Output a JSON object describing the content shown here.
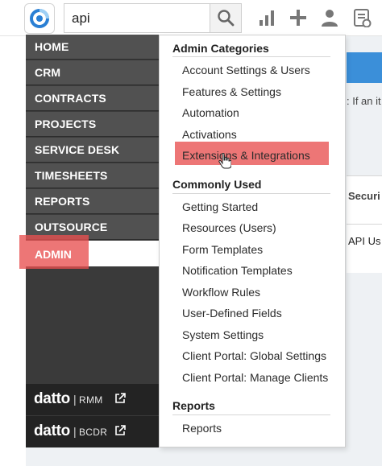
{
  "search": {
    "value": "api"
  },
  "nav": {
    "items": [
      {
        "label": "HOME"
      },
      {
        "label": "CRM"
      },
      {
        "label": "CONTRACTS"
      },
      {
        "label": "PROJECTS"
      },
      {
        "label": "SERVICE DESK"
      },
      {
        "label": "TIMESHEETS"
      },
      {
        "label": "REPORTS"
      },
      {
        "label": "OUTSOURCE"
      }
    ],
    "active": {
      "label": "ADMIN"
    },
    "footer": [
      {
        "brand": "datto",
        "separator": "|",
        "product": "RMM"
      },
      {
        "brand": "datto",
        "separator": "|",
        "product": "BCDR"
      }
    ]
  },
  "menu": {
    "admin_categories": {
      "title": "Admin Categories",
      "items": [
        "Account Settings & Users",
        "Features & Settings",
        "Automation",
        "Activations",
        "Extensions & Integrations"
      ]
    },
    "commonly_used": {
      "title": "Commonly Used",
      "items": [
        "Getting Started",
        "Resources (Users)",
        "Form Templates",
        "Notification Templates",
        "Workflow Rules",
        "User-Defined Fields",
        "System Settings",
        "Client Portal: Global Settings",
        "Client Portal: Manage Clients"
      ]
    },
    "reports": {
      "title": "Reports",
      "items": [
        "Reports"
      ]
    }
  },
  "background": {
    "info_text": ": If an it",
    "column_header": "Securi",
    "cell": "API Us"
  },
  "colors": {
    "highlight": "#e85050",
    "nav_bg": "#515151",
    "banner": "#3b8fd9"
  }
}
